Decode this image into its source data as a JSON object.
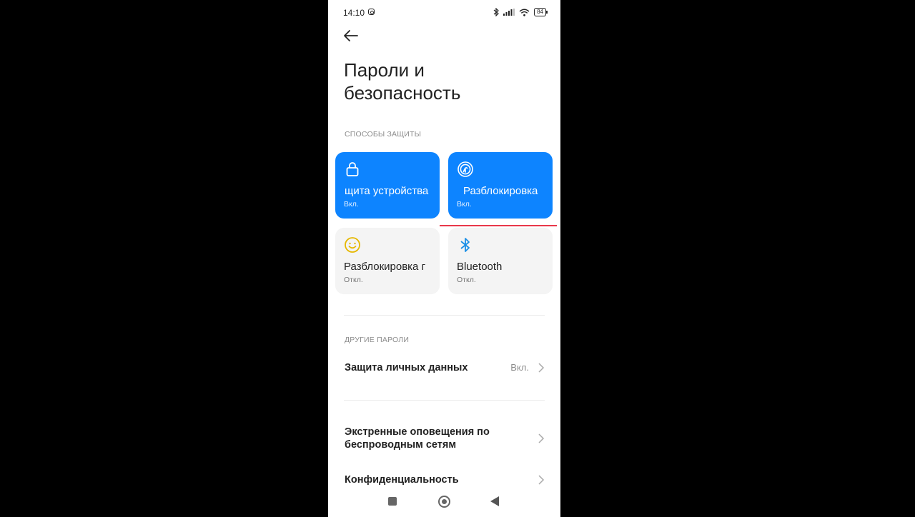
{
  "status_bar": {
    "time": "14:10",
    "battery": "84"
  },
  "header": {
    "title_line1": "Пароли и",
    "title_line2": "безопасность"
  },
  "sections": {
    "protection": "СПОСОБЫ ЗАЩИТЫ",
    "other": "ДРУГИЕ ПАРОЛИ"
  },
  "tiles": [
    {
      "name": "щита устройства",
      "status": "Вкл.",
      "icon": "lock-icon",
      "state": "on"
    },
    {
      "name": "Разблокировка",
      "status": "Вкл.",
      "icon": "fingerprint-icon",
      "state": "on"
    },
    {
      "name": "Разблокировка г",
      "status": "Откл.",
      "icon": "face-icon",
      "state": "off"
    },
    {
      "name": "Bluetooth",
      "status": "Откл.",
      "icon": "bluetooth-icon",
      "state": "off"
    }
  ],
  "rows": {
    "privacy": {
      "label": "Защита личных данных",
      "value": "Вкл."
    },
    "alerts_line1": "Экстренные оповещения по",
    "alerts_line2": "беспроводным сетям",
    "confidentiality": "Конфиденциальность"
  },
  "colors": {
    "accent": "#0d84ff",
    "highlight_line": "#e8374a"
  }
}
